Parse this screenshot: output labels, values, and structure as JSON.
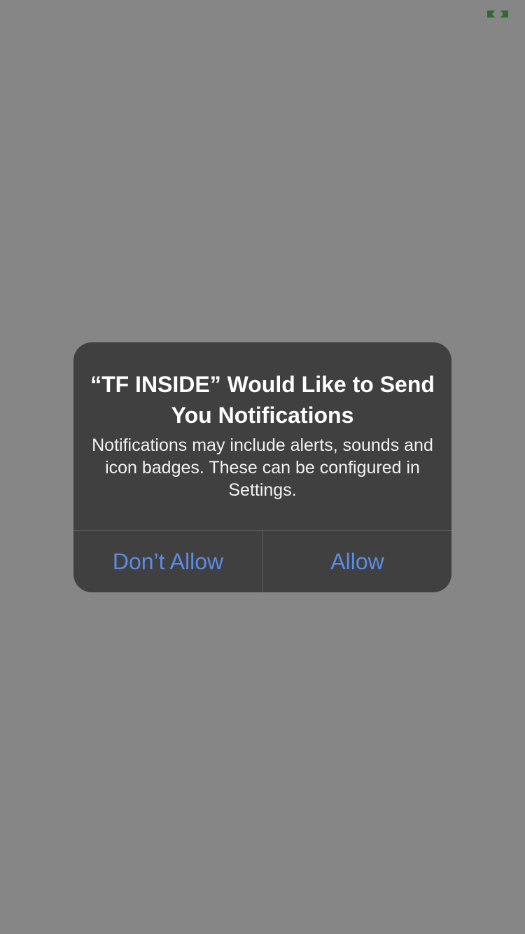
{
  "status_bar": {
    "icon": "battery-icon",
    "icon_color": "#2f6a2f"
  },
  "alert": {
    "title": "“TF INSIDE” Would Like to Send You Notifications",
    "message": "Notifications may include alerts, sounds and icon badges. These can be configured in Settings.",
    "buttons": {
      "deny_label": "Don’t Allow",
      "allow_label": "Allow"
    },
    "button_color": "#5b8ce6",
    "background_color": "#404040"
  },
  "screen": {
    "background_color": "#868686"
  }
}
